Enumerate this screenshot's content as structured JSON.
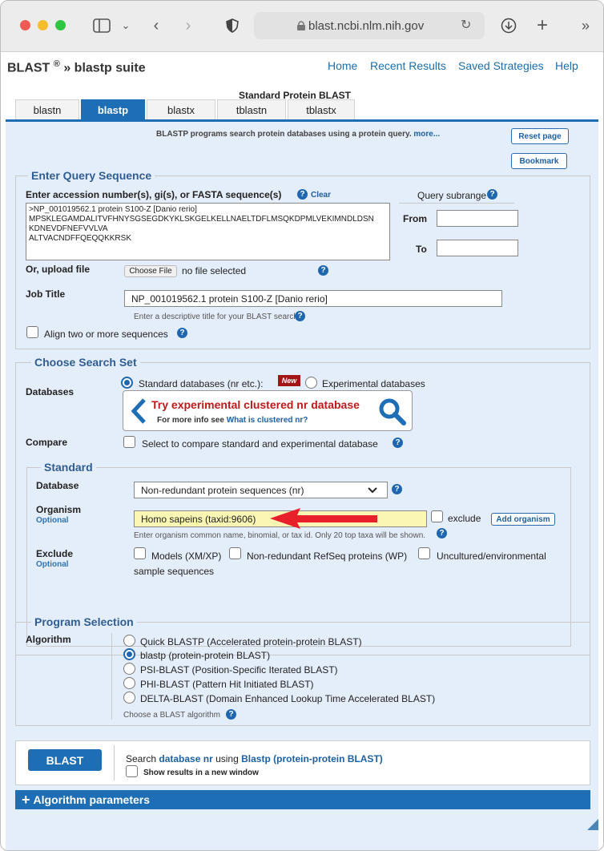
{
  "browser": {
    "url": "blast.ncbi.nlm.nih.gov",
    "colors": {
      "close": "#ee5b54",
      "minimize": "#f5bd2d",
      "zoom": "#2fc742"
    }
  },
  "header": {
    "brand": "BLAST",
    "reg": "®",
    "suite": " » blastp suite",
    "nav": [
      "Home",
      "Recent Results",
      "Saved Strategies",
      "Help"
    ]
  },
  "page_title": "Standard Protein BLAST",
  "tabs": [
    "blastn",
    "blastp",
    "blastx",
    "tblastn",
    "tblastx"
  ],
  "intro": {
    "text": "BLASTP programs search protein databases using a protein query.",
    "more": "more..."
  },
  "buttons": {
    "reset": "Reset page",
    "bookmark": "Bookmark"
  },
  "query": {
    "legend": "Enter Query Sequence",
    "label": "Enter accession number(s), gi(s), or FASTA sequence(s)",
    "clear": "Clear",
    "sequence": ">NP_001019562.1 protein S100-Z [Danio rerio]\nMPSKLEGAMDALITVFHNYSGSEGDKYKLSKGELKELLNAELTDFLMSQKDPMLVEKIMNDLDSN\nKDNEVDFNEFVVLVA\nALTVACNDFFQEQQKKRSK",
    "subrange": "Query subrange",
    "from": "From",
    "to": "To",
    "upload_label": "Or, upload file",
    "choose_file": "Choose File",
    "no_file": "no file selected",
    "job_title_label": "Job Title",
    "job_title": "NP_001019562.1 protein S100-Z [Danio rerio]",
    "job_hint": "Enter a descriptive title for your BLAST search",
    "align_two": "Align two or more sequences"
  },
  "search_set": {
    "legend": "Choose Search Set",
    "databases": "Databases",
    "standard_db": "Standard databases (nr etc.):",
    "new_badge": "New",
    "experimental_db": "Experimental databases",
    "promo_title": "Try experimental clustered nr database",
    "promo_sub": "For more info see",
    "promo_link": "What is clustered nr?",
    "compare": "Compare",
    "compare_text": "Select to compare standard and experimental database"
  },
  "standard": {
    "legend": "Standard",
    "database_label": "Database",
    "database_value": "Non-redundant protein sequences (nr)",
    "organism_label": "Organism",
    "optional": "Optional",
    "organism_value": "Homo sapeins (taxid:9606)",
    "exclude_word": "exclude",
    "add_organism": "Add organism",
    "organism_hint": "Enter organism common name, binomial, or tax id. Only 20 top taxa will be shown.",
    "exclude_label": "Exclude",
    "exclude_models": "Models (XM/XP)",
    "exclude_nr": "Non-redundant RefSeq proteins (WP)",
    "exclude_unc": "Uncultured/environmental",
    "exclude_unc2": "sample sequences",
    "arrow_color": "#e8202a"
  },
  "program": {
    "legend": "Program Selection",
    "algorithm": "Algorithm",
    "options": [
      "Quick BLASTP (Accelerated protein-protein BLAST)",
      "blastp (protein-protein BLAST)",
      "PSI-BLAST (Position-Specific Iterated BLAST)",
      "PHI-BLAST (Pattern Hit Initiated BLAST)",
      "DELTA-BLAST (Domain Enhanced Lookup Time Accelerated BLAST)"
    ],
    "hint": "Choose a BLAST algorithm"
  },
  "submit": {
    "button": "BLAST",
    "s1": "Search",
    "db": "database nr",
    "s2": "using",
    "prog": "Blastp (protein-protein BLAST)",
    "new_window": "Show results in a new window"
  },
  "algo_params": "Algorithm parameters"
}
